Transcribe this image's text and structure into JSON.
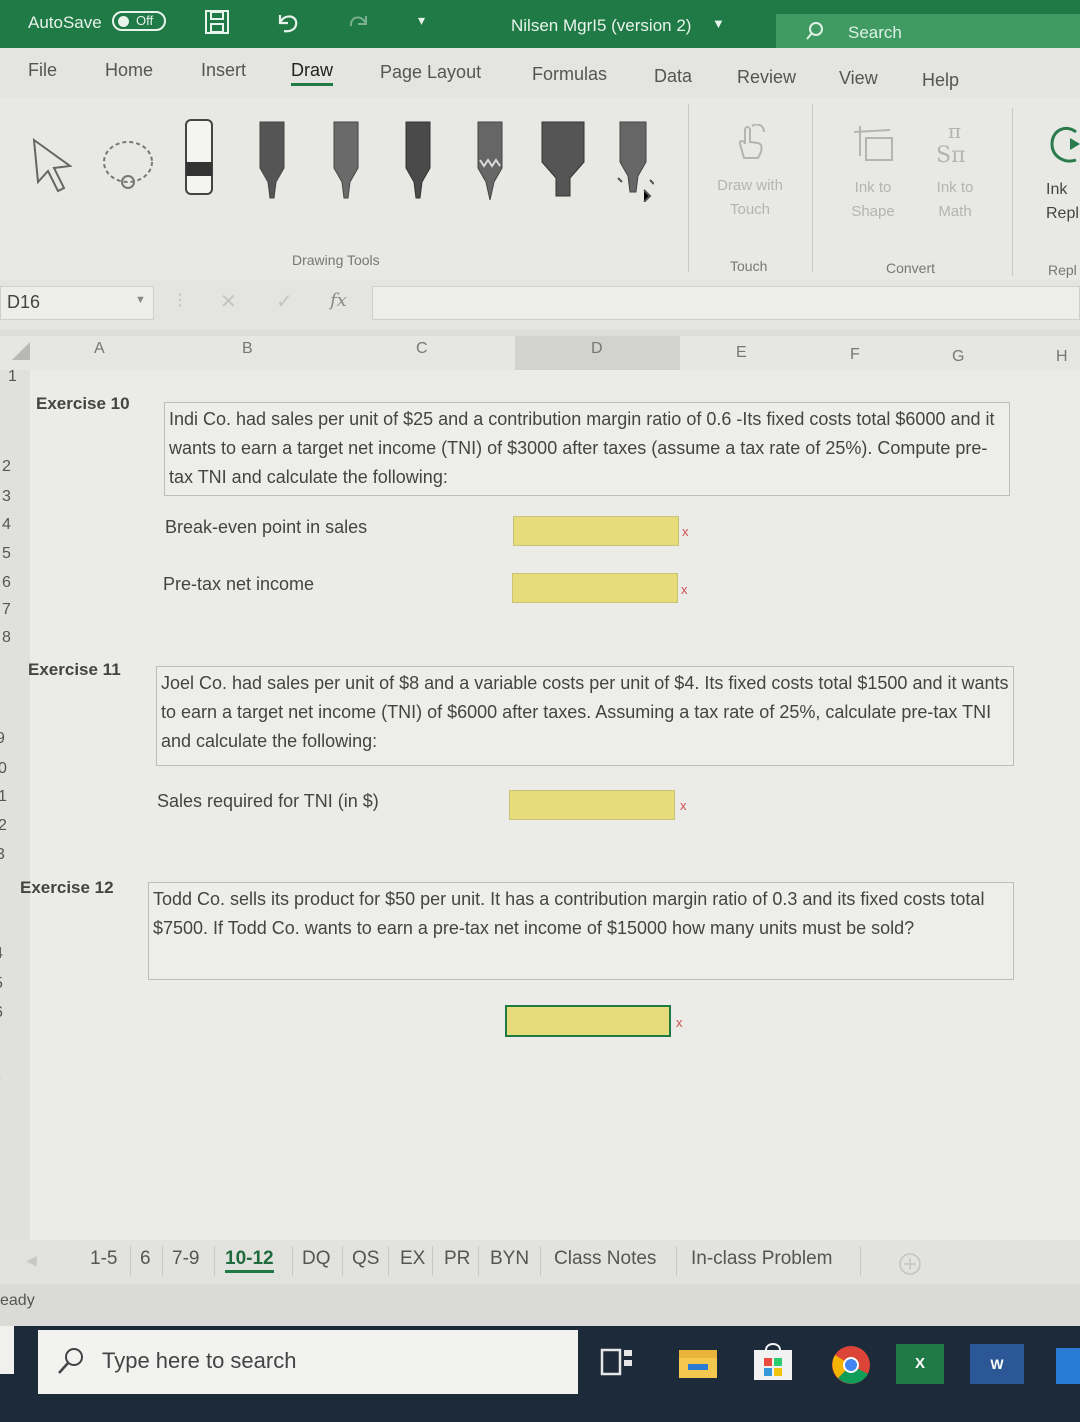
{
  "titlebar": {
    "autosave_label": "AutoSave",
    "autosave_state": "Off",
    "document_title": "Nilsen MgrI5 (version 2)",
    "search_placeholder": "Search"
  },
  "tabs": [
    "File",
    "Home",
    "Insert",
    "Draw",
    "Page Layout",
    "Formulas",
    "Data",
    "Review",
    "View",
    "Help"
  ],
  "active_tab": "Draw",
  "ribbon": {
    "drawing_tools_label": "Drawing Tools",
    "draw_with_touch": [
      "Draw with",
      "Touch"
    ],
    "touch_label": "Touch",
    "ink_to_shape": [
      "Ink to",
      "Shape"
    ],
    "ink_to_math": [
      "Ink to",
      "Math"
    ],
    "convert_label": "Convert",
    "ink_replay": [
      "Ink",
      "Repl"
    ],
    "replay_label": "Repl"
  },
  "formula_bar": {
    "cell_ref": "D16",
    "fx": "fx"
  },
  "columns": [
    "A",
    "B",
    "C",
    "D",
    "E",
    "F",
    "G",
    "H"
  ],
  "row_numbers": [
    "1",
    "2",
    "3",
    "4",
    "5",
    "6",
    "7",
    "8",
    "9",
    "0",
    "1",
    "2",
    "3",
    "4",
    "5",
    "6",
    "7",
    "8"
  ],
  "exercises": {
    "ex10": {
      "title": "Exercise 10",
      "text": "Indi Co. had sales per unit of $25 and a contribution margin ratio of 0.6 -Its fixed costs total $6000 and it wants to earn a target net income (TNI) of $3000 after taxes (assume a tax rate of 25%). Compute pre-tax TNI and calculate the following:",
      "q1": "Break-even point in sales",
      "q2": "Pre-tax net income"
    },
    "ex11": {
      "title": "Exercise 11",
      "text": "Joel Co. had sales per unit of $8 and a variable costs per unit of $4. Its fixed costs total $1500 and it wants to earn a target net income (TNI) of $6000 after taxes. Assuming a tax rate of 25%, calculate pre-tax TNI and calculate the following:",
      "q1": "Sales required for TNI (in $)"
    },
    "ex12": {
      "title": "Exercise 12",
      "text": "Todd Co. sells its product for $50 per unit. It has a contribution margin ratio of 0.3 and its fixed costs total $7500. If Todd Co. wants to earn a pre-tax net income of $15000 how many units must be sold?"
    },
    "x_mark": "x"
  },
  "sheet_tabs": [
    "1-5",
    "6",
    "7-9",
    "10-12",
    "DQ",
    "QS",
    "EX",
    "PR",
    "BYN",
    "Class Notes",
    "In-class Problem"
  ],
  "active_sheet": "10-12",
  "status": "eady",
  "taskbar": {
    "search_placeholder": "Type here to search",
    "excel_letter": "X",
    "word_letter": "W"
  },
  "colors": {
    "excel_green": "#1f7a45",
    "answer_fill": "#e6dd7a",
    "error_x": "#d05050"
  }
}
